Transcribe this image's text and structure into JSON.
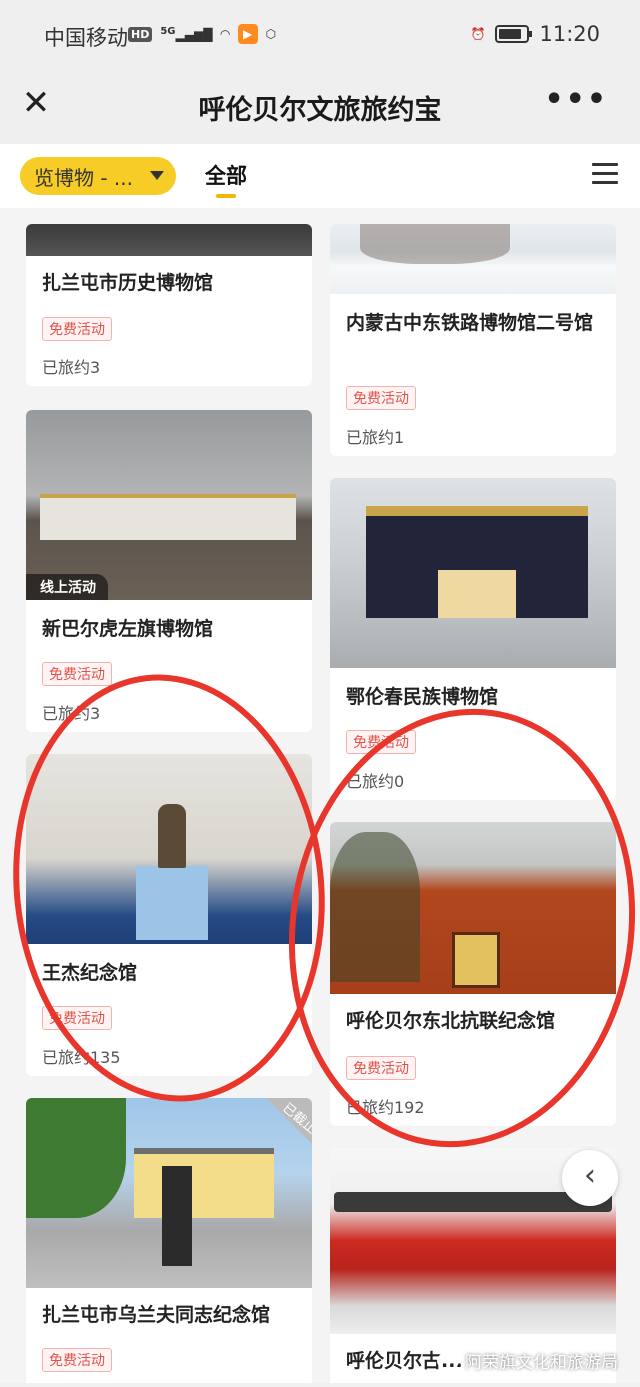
{
  "status_bar": {
    "carrier": "中国移动",
    "hd_badge": "HD",
    "network": "5G",
    "time": "11:20"
  },
  "header": {
    "title": "呼伦贝尔文旅旅约宝",
    "close_icon": "close-icon",
    "more_icon": "more-icon"
  },
  "filter": {
    "category_label": "览博物 - ...",
    "tab_all": "全部"
  },
  "cards": [
    {
      "title": "扎兰屯市历史博物馆",
      "badge": "免费活动",
      "visits": "已旅约3"
    },
    {
      "title": "内蒙古中东铁路博物馆二号馆",
      "badge": "免费活动",
      "visits": "已旅约1"
    },
    {
      "title": "新巴尔虎左旗博物馆",
      "badge": "免费活动",
      "visits": "已旅约3",
      "tag": "线上活动"
    },
    {
      "title": "鄂伦春民族博物馆",
      "badge": "免费活动",
      "visits": "已旅约0"
    },
    {
      "title": "王杰纪念馆",
      "badge": "免费活动",
      "visits": "已旅约135"
    },
    {
      "title": "呼伦贝尔东北抗联纪念馆",
      "badge": "免费活动",
      "visits": "已旅约192"
    },
    {
      "title": "扎兰屯市乌兰夫同志纪念馆",
      "badge": "免费活动",
      "corner_tag": "已截止"
    },
    {
      "title": "呼伦贝尔古..."
    }
  ],
  "watermark": "阿荣旗文化和旅游局",
  "colors": {
    "accent_yellow": "#f7cc26",
    "badge_red": "#e0534c",
    "annotation_red": "#e8362c"
  }
}
